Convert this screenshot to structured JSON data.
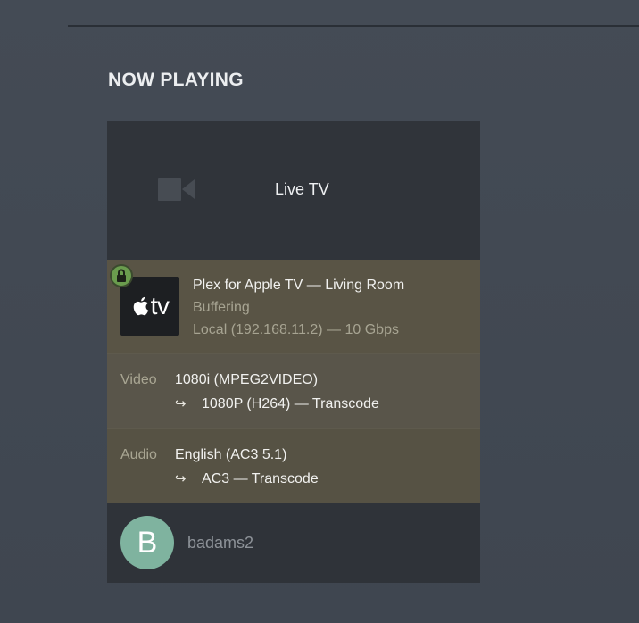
{
  "section": {
    "title": "NOW PLAYING"
  },
  "media": {
    "title": "Live TV",
    "icon": "video-camera-icon"
  },
  "player": {
    "logo_icon": "apple-tv-logo",
    "logo_text": "tv",
    "secure_icon": "lock-icon",
    "name_line": "Plex for Apple TV  —  Living Room",
    "state": "Buffering",
    "network": "Local (192.168.11.2) — 10 Gbps"
  },
  "video": {
    "label": "Video",
    "source": "1080i (MPEG2VIDEO)",
    "arrow": "↪",
    "target": "1080P (H264) — Transcode"
  },
  "audio": {
    "label": "Audio",
    "source": "English (AC3 5.1)",
    "arrow": "↪",
    "target": "AC3 — Transcode"
  },
  "user": {
    "initial": "B",
    "name": "badams2",
    "avatar_color": "#7fb39f"
  },
  "colors": {
    "background": "#3f4650",
    "card": "#2f3339",
    "stream_panel": "#595445",
    "lock_badge": "#6a9c4e"
  }
}
